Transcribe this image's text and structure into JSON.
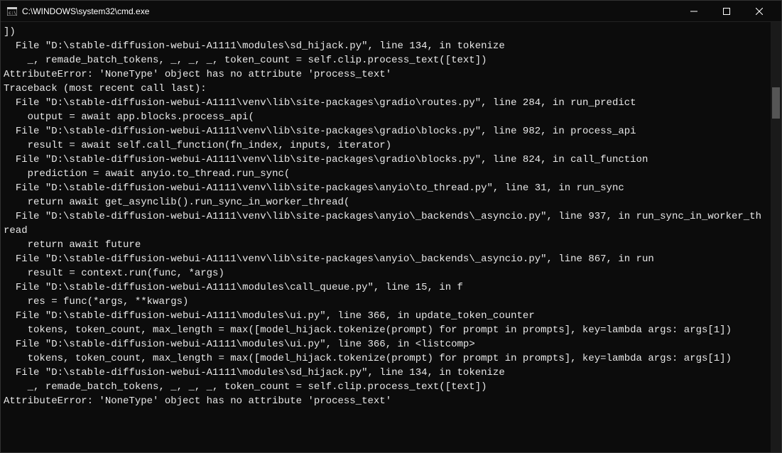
{
  "window": {
    "title": "C:\\WINDOWS\\system32\\cmd.exe"
  },
  "terminal": {
    "lines": [
      "])",
      "  File \"D:\\stable-diffusion-webui-A1111\\modules\\sd_hijack.py\", line 134, in tokenize",
      "    _, remade_batch_tokens, _, _, _, token_count = self.clip.process_text([text])",
      "AttributeError: 'NoneType' object has no attribute 'process_text'",
      "Traceback (most recent call last):",
      "  File \"D:\\stable-diffusion-webui-A1111\\venv\\lib\\site-packages\\gradio\\routes.py\", line 284, in run_predict",
      "    output = await app.blocks.process_api(",
      "  File \"D:\\stable-diffusion-webui-A1111\\venv\\lib\\site-packages\\gradio\\blocks.py\", line 982, in process_api",
      "    result = await self.call_function(fn_index, inputs, iterator)",
      "  File \"D:\\stable-diffusion-webui-A1111\\venv\\lib\\site-packages\\gradio\\blocks.py\", line 824, in call_function",
      "    prediction = await anyio.to_thread.run_sync(",
      "  File \"D:\\stable-diffusion-webui-A1111\\venv\\lib\\site-packages\\anyio\\to_thread.py\", line 31, in run_sync",
      "    return await get_asynclib().run_sync_in_worker_thread(",
      "  File \"D:\\stable-diffusion-webui-A1111\\venv\\lib\\site-packages\\anyio\\_backends\\_asyncio.py\", line 937, in run_sync_in_worker_thread",
      "    return await future",
      "  File \"D:\\stable-diffusion-webui-A1111\\venv\\lib\\site-packages\\anyio\\_backends\\_asyncio.py\", line 867, in run",
      "    result = context.run(func, *args)",
      "  File \"D:\\stable-diffusion-webui-A1111\\modules\\call_queue.py\", line 15, in f",
      "    res = func(*args, **kwargs)",
      "  File \"D:\\stable-diffusion-webui-A1111\\modules\\ui.py\", line 366, in update_token_counter",
      "    tokens, token_count, max_length = max([model_hijack.tokenize(prompt) for prompt in prompts], key=lambda args: args[1])",
      "  File \"D:\\stable-diffusion-webui-A1111\\modules\\ui.py\", line 366, in <listcomp>",
      "    tokens, token_count, max_length = max([model_hijack.tokenize(prompt) for prompt in prompts], key=lambda args: args[1])",
      "  File \"D:\\stable-diffusion-webui-A1111\\modules\\sd_hijack.py\", line 134, in tokenize",
      "    _, remade_batch_tokens, _, _, _, token_count = self.clip.process_text([text])",
      "AttributeError: 'NoneType' object has no attribute 'process_text'"
    ]
  }
}
